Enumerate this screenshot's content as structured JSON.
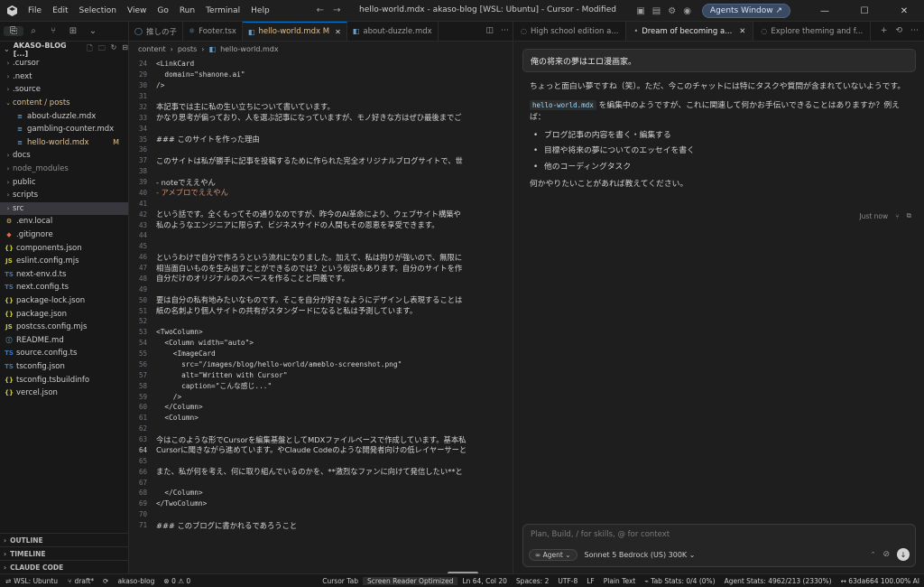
{
  "titlebar": {
    "menu": [
      "File",
      "Edit",
      "Selection",
      "View",
      "Go",
      "Run",
      "Terminal",
      "Help"
    ],
    "title": "hello-world.mdx - akaso-blog [WSL: Ubuntu] - Cursor - Modified",
    "agents_button": "Agents Window ↗",
    "win_min": "—",
    "win_max": "☐",
    "win_close": "✕"
  },
  "sidebar": {
    "header": "AKASO-BLOG [...]",
    "items": [
      {
        "label": ".cursor",
        "icon": "chevron",
        "type": "folder"
      },
      {
        "label": ".next",
        "icon": "chevron",
        "type": "folder"
      },
      {
        "label": ".source",
        "icon": "chevron",
        "type": "folder"
      },
      {
        "label": "content / posts",
        "icon": "chevron-open",
        "type": "folder-open",
        "modified": true
      },
      {
        "label": "about-duzzle.mdx",
        "icon": "md",
        "type": "file"
      },
      {
        "label": "gambling-counter.mdx",
        "icon": "md",
        "type": "file"
      },
      {
        "label": "hello-world.mdx",
        "icon": "md",
        "type": "file",
        "modified": true,
        "badge": "M"
      },
      {
        "label": "docs",
        "icon": "chevron",
        "type": "folder"
      },
      {
        "label": "node_modules",
        "icon": "chevron",
        "type": "folder",
        "dim": true
      },
      {
        "label": "public",
        "icon": "chevron",
        "type": "folder"
      },
      {
        "label": "scripts",
        "icon": "chevron",
        "type": "folder"
      },
      {
        "label": "src",
        "icon": "chevron",
        "type": "folder",
        "selected": true
      },
      {
        "label": ".env.local",
        "icon": "env",
        "type": "file"
      },
      {
        "label": ".gitignore",
        "icon": "git",
        "type": "file"
      },
      {
        "label": "components.json",
        "icon": "json",
        "type": "file"
      },
      {
        "label": "eslint.config.mjs",
        "icon": "js",
        "type": "file"
      },
      {
        "label": "next-env.d.ts",
        "icon": "ts",
        "type": "file"
      },
      {
        "label": "next.config.ts",
        "icon": "ts",
        "type": "file"
      },
      {
        "label": "package-lock.json",
        "icon": "json",
        "type": "file"
      },
      {
        "label": "package.json",
        "icon": "json",
        "type": "file"
      },
      {
        "label": "postcss.config.mjs",
        "icon": "js",
        "type": "file"
      },
      {
        "label": "README.md",
        "icon": "info",
        "type": "file"
      },
      {
        "label": "source.config.ts",
        "icon": "ts",
        "type": "file"
      },
      {
        "label": "tsconfig.json",
        "icon": "ts",
        "type": "file"
      },
      {
        "label": "tsconfig.tsbuildinfo",
        "icon": "json",
        "type": "file"
      },
      {
        "label": "vercel.json",
        "icon": "json",
        "type": "file"
      }
    ],
    "sections": [
      "OUTLINE",
      "TIMELINE",
      "CLAUDE CODE"
    ]
  },
  "editor": {
    "tabs": [
      {
        "label": "推しの子",
        "active": false
      },
      {
        "label": "Footer.tsx",
        "active": false
      },
      {
        "label": "hello-world.mdx M",
        "active": true
      },
      {
        "label": "about-duzzle.mdx",
        "active": false
      }
    ],
    "breadcrumb": [
      "content",
      "posts",
      "hello-world.mdx"
    ],
    "lines": [
      {
        "n": "24",
        "t": "<LinkCard",
        "mono": true
      },
      {
        "n": "29",
        "t": "  domain=\"shanone.ai\"",
        "mono": true
      },
      {
        "n": "30",
        "t": "/>",
        "mono": true
      },
      {
        "n": "31",
        "t": ""
      },
      {
        "n": "32",
        "t": "本記事では主に私の生い立ちについて書いています。"
      },
      {
        "n": "33",
        "t": "かなり思考が偏っており、人を選ぶ記事になっていますが、モノ好きな方はぜひ最後までご"
      },
      {
        "n": "34",
        "t": ""
      },
      {
        "n": "35",
        "t": "### このサイトを作った理由"
      },
      {
        "n": "36",
        "t": ""
      },
      {
        "n": "37",
        "t": "このサイトは私が勝手に記事を投稿するために作られた完全オリジナルブログサイトで、世"
      },
      {
        "n": "38",
        "t": ""
      },
      {
        "n": "39",
        "t": "- noteでええやん"
      },
      {
        "n": "40",
        "t": "- アメブロでええやん"
      },
      {
        "n": "41",
        "t": ""
      },
      {
        "n": "42",
        "t": "という話です。全くもってその通りなのですが、昨今のAI革命により、ウェブサイト構築や"
      },
      {
        "n": "43",
        "t": "私のようなエンジニアに限らず、ビジネスサイドの人間もその恩恵を享受できます。"
      },
      {
        "n": "44",
        "t": ""
      },
      {
        "n": "45",
        "t": ""
      },
      {
        "n": "46",
        "t": "というわけで自分で作ろうという流れになりました。加えて、私は拘りが強いので、無限に"
      },
      {
        "n": "47",
        "t": "相当面白いものを生み出すことができるのでは？という仮説もあります。自分のサイトを作"
      },
      {
        "n": "48",
        "t": "自分だけのオリジナルのスペースを作ることと同義です。"
      },
      {
        "n": "49",
        "t": ""
      },
      {
        "n": "50",
        "t": "要は自分の私有地みたいなものです。そこを自分が好きなようにデザインし表現することは"
      },
      {
        "n": "51",
        "t": "紙の名刺より個人サイトの共有がスタンダードになると私は予測しています。"
      },
      {
        "n": "52",
        "t": ""
      },
      {
        "n": "53",
        "t": "<TwoColumn>",
        "mono": true
      },
      {
        "n": "54",
        "t": "  <Column width=\"auto\">",
        "mono": true
      },
      {
        "n": "55",
        "t": "    <ImageCard",
        "mono": true
      },
      {
        "n": "56",
        "t": "      src=\"/images/blog/hello-world/ameblo-screenshot.png\"",
        "mono": true
      },
      {
        "n": "57",
        "t": "      alt=\"Written with Cursor\"",
        "mono": true
      },
      {
        "n": "58",
        "t": "      caption=\"こんな感じ...\"",
        "mono": true
      },
      {
        "n": "59",
        "t": "    />",
        "mono": true
      },
      {
        "n": "60",
        "t": "  </Column>",
        "mono": true
      },
      {
        "n": "61",
        "t": "  <Column>",
        "mono": true
      },
      {
        "n": "62",
        "t": ""
      },
      {
        "n": "63",
        "t": "今はこのような形でCursorを編集基盤としてMDXファイルベースで作成しています。基本私"
      },
      {
        "n": "64",
        "t": "Cursorに聞きながら進めています。やClaude Codeのような開発者向けの低レイヤーサーと",
        "cur": true
      },
      {
        "n": "65",
        "t": ""
      },
      {
        "n": "66",
        "t": "また、私が何を考え、何に取り組んでいるのかを、**激烈なファンに向けて発信したい**と"
      },
      {
        "n": "67",
        "t": ""
      },
      {
        "n": "68",
        "t": "  </Column>",
        "mono": true
      },
      {
        "n": "69",
        "t": "</TwoColumn>",
        "mono": true
      },
      {
        "n": "70",
        "t": ""
      },
      {
        "n": "71",
        "t": "### このブログに書かれるであろうこと"
      }
    ]
  },
  "chat": {
    "tabs": [
      {
        "label": "High school edition a...",
        "active": false
      },
      {
        "label": "Dream of becoming a...",
        "active": true
      },
      {
        "label": "Explore theming and f...",
        "active": false
      }
    ],
    "user_message": "俺の将来の夢はエロ漫画家。",
    "reply_p1": "ちょっと面白い夢ですね（笑）。ただ、今このチャットには特にタスクや質問が含まれていないようです。",
    "reply_code": "hello-world.mdx",
    "reply_p2": "を編集中のようですが、これに関連して何かお手伝いできることはありますか？例えば：",
    "reply_list": [
      "ブログ記事の内容を書く・編集する",
      "目標や将来の夢についてのエッセイを書く",
      "他のコーディングタスク"
    ],
    "reply_p3": "何かやりたいことがあれば教えてください。",
    "timestamp": "Just now",
    "composer_placeholder": "Plan, Build, / for skills, @ for context",
    "agent_label": "∞ Agent ⌄",
    "model_label": "Sonnet 5 Bedrock (US) 300K ⌄"
  },
  "statusbar": {
    "remote": "WSL: Ubuntu",
    "branch": "draft*",
    "sync": "⟳",
    "project": "akaso-blog",
    "problems": "⊗ 0 ⚠ 0",
    "cursor_tab": "Cursor Tab",
    "screen_reader": "Screen Reader Optimized",
    "position": "Ln 64, Col 20",
    "spaces": "Spaces: 2",
    "encoding": "UTF-8",
    "eol": "LF",
    "language": "Plain Text",
    "tab_stats": "⌁ Tab Stats: 0/4 (0%)",
    "agent_stats": "Agent Stats: 4962/213 (2330%)",
    "commit": "↔ 63da664 100.00% AI"
  }
}
